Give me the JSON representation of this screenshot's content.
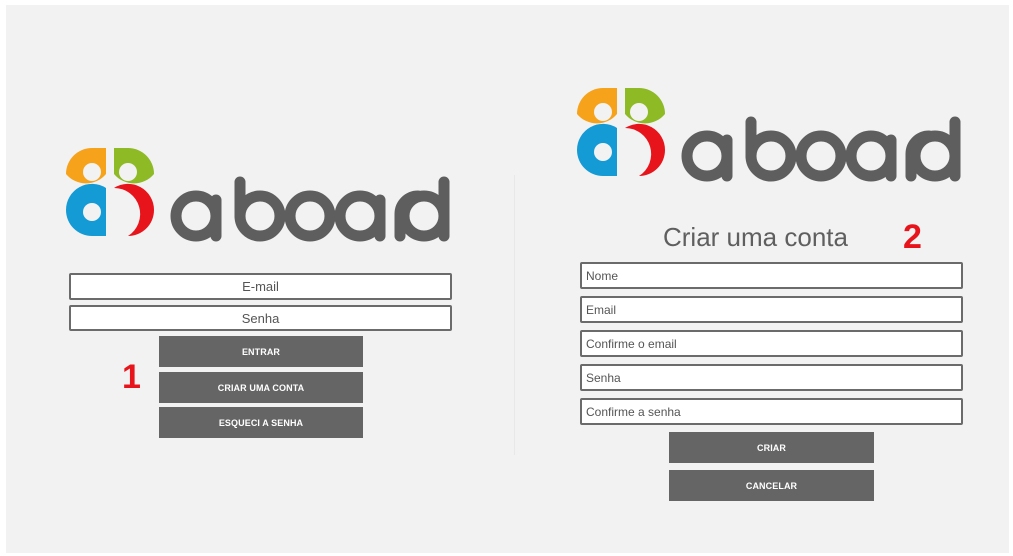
{
  "brand": {
    "name": "aboard",
    "colors": {
      "orange": "#f6a21a",
      "green": "#8dba25",
      "blue": "#149bd6",
      "red": "#e8141b",
      "wordmark": "#5e5e5e"
    }
  },
  "login_screen": {
    "step_marker": "1",
    "email": {
      "placeholder": "E-mail",
      "value": ""
    },
    "password": {
      "placeholder": "Senha",
      "value": ""
    },
    "buttons": {
      "enter": "ENTRAR",
      "create_account": "CRIAR UMA CONTA",
      "forgot_password": "ESQUECI A SENHA"
    }
  },
  "signup_screen": {
    "step_marker": "2",
    "title": "Criar uma conta",
    "fields": {
      "name": {
        "placeholder": "Nome",
        "value": ""
      },
      "email": {
        "placeholder": "Email",
        "value": ""
      },
      "confirm_email": {
        "placeholder": "Confirme o email",
        "value": ""
      },
      "password": {
        "placeholder": "Senha",
        "value": ""
      },
      "confirm_password": {
        "placeholder": "Confirme a senha",
        "value": ""
      }
    },
    "buttons": {
      "create": "CRIAR",
      "cancel": "CANCELAR"
    },
    "button_color": "#656565"
  }
}
